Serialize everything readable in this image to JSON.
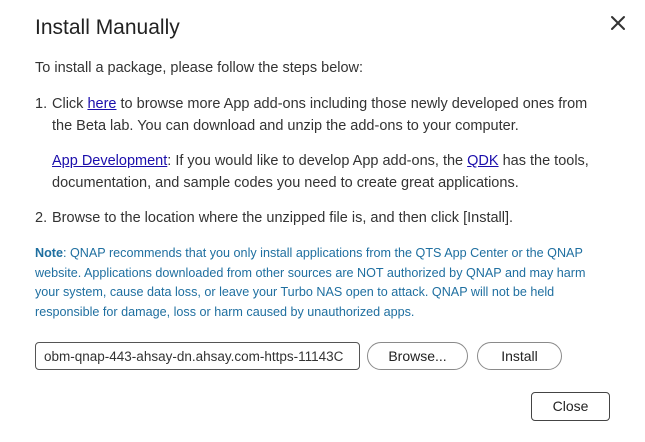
{
  "dialog": {
    "title": "Install Manually",
    "intro": "To install a package, please follow the steps below:",
    "step1": {
      "number": "1.",
      "text_before_link": "Click ",
      "link": "here",
      "text_after_link": " to browse more App add-ons including those newly developed ones from the Beta lab. You can download and unzip the add-ons to your computer."
    },
    "app_development": {
      "link": "App Development",
      "text_before_qdk": ": If you would like to develop App add-ons, the ",
      "qdk_link": "QDK",
      "text_after_qdk": " has the tools, documentation, and sample codes you need to create great applications."
    },
    "step2": {
      "number": "2.",
      "text": "Browse to the location where the unzipped file is, and then click [Install]."
    },
    "note": {
      "label": "Note",
      "text": ": QNAP recommends that you only install applications from the QTS App Center or the QNAP website. Applications downloaded from other sources are NOT authorized by QNAP and may harm your system, cause data loss, or leave your Turbo NAS open to attack. QNAP will not be held responsible for damage, loss or harm caused by unauthorized apps."
    },
    "file_input_value": "obm-qnap-443-ahsay-dn.ahsay.com-https-11143C",
    "browse_label": "Browse...",
    "install_label": "Install",
    "close_label": "Close",
    "close_icon": "close-icon",
    "colors": {
      "note": "#1f6fa0",
      "link": "#1a0dab"
    }
  }
}
